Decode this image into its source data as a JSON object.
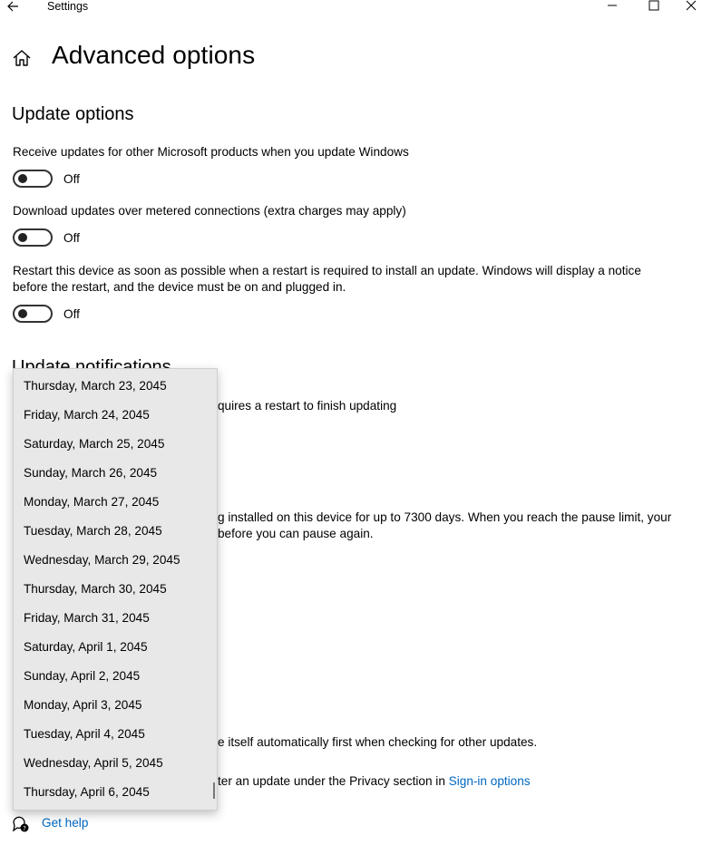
{
  "window": {
    "title": "Settings"
  },
  "page": {
    "title": "Advanced options"
  },
  "update_options": {
    "heading": "Update options",
    "items": [
      {
        "label": "Receive updates for other Microsoft products when you update Windows",
        "state": "Off"
      },
      {
        "label": "Download updates over metered connections (extra charges may apply)",
        "state": "Off"
      },
      {
        "label_line1": "Restart this device as soon as possible when a restart is required to install an update. Windows will display a notice",
        "label_line2": "before the restart, and the device must be on and plugged in.",
        "state": "Off"
      }
    ]
  },
  "update_notifications": {
    "heading": "Update notifications",
    "partial_text": "quires a restart to finish updating"
  },
  "pause": {
    "partial_line1": "g installed on this device for up to 7300 days. When you reach the pause limit, your",
    "partial_line2": "before you can pause again."
  },
  "delivery": {
    "partial_text": "e itself automatically first when checking for other updates."
  },
  "privacy": {
    "partial_text": "ter an update under the Privacy section in ",
    "link": "Sign-in options"
  },
  "help": {
    "label": "Get help"
  },
  "date_dropdown": {
    "options": [
      "Thursday, March 23, 2045",
      "Friday, March 24, 2045",
      "Saturday, March 25, 2045",
      "Sunday, March 26, 2045",
      "Monday, March 27, 2045",
      "Tuesday, March 28, 2045",
      "Wednesday, March 29, 2045",
      "Thursday, March 30, 2045",
      "Friday, March 31, 2045",
      "Saturday, April 1, 2045",
      "Sunday, April 2, 2045",
      "Monday, April 3, 2045",
      "Tuesday, April 4, 2045",
      "Wednesday, April 5, 2045",
      "Thursday, April 6, 2045"
    ]
  },
  "icons": {
    "back": "back-arrow-icon",
    "minimize": "minimize-icon",
    "maximize": "maximize-icon",
    "close": "close-icon",
    "home": "home-icon",
    "help": "help-chat-icon"
  }
}
